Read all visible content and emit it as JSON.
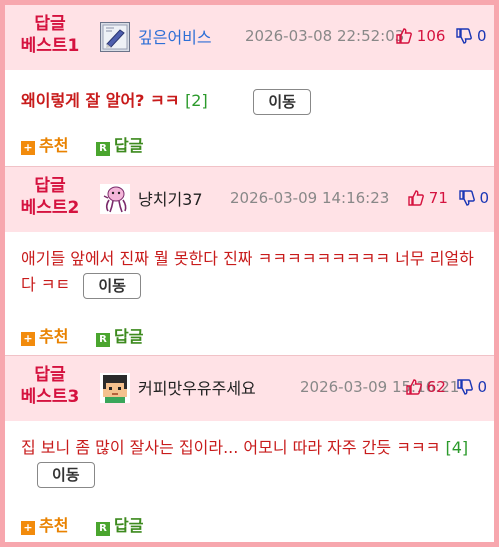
{
  "posts": [
    {
      "best_line1": "답글",
      "best_line2": "베스트1",
      "avatar": "paper-notebook-icon",
      "nick": "깊은어비스",
      "nick_color": "#2d6fd6",
      "time": "2026-03-08 22:52:03",
      "up": "106",
      "down": "0",
      "content": "왜이렇게 잘 알어? ㅋㅋ",
      "count": "[2]",
      "move": "이동",
      "recommend": "추천",
      "reply": "답글"
    },
    {
      "best_line1": "답글",
      "best_line2": "베스트2",
      "avatar": "octopus-icon",
      "nick": "냥치기37",
      "nick_color": "#222222",
      "time": "2026-03-09 14:16:23",
      "up": "71",
      "down": "0",
      "content": "애기들 앞에서 진짜 뭘 못한다 진짜 ㅋㅋㅋㅋㅋㅋㅋㅋㅋ 너무 리얼하다 ㅋㅌ",
      "count": "",
      "move": "이동",
      "recommend": "추천",
      "reply": "답글"
    },
    {
      "best_line1": "답글",
      "best_line2": "베스트3",
      "avatar": "pixel-face-icon",
      "nick": "커피맛우유주세요",
      "nick_color": "#222222",
      "time": "2026-03-09 15:16:21",
      "up": "62",
      "down": "0",
      "content": "집 보니 좀 많이 잘사는 집이라... 어모니 따라 자주 간듯 ㅋㅋㅋ",
      "count": "[4]",
      "move": "이동",
      "recommend": "추천",
      "reply": "답글"
    }
  ]
}
